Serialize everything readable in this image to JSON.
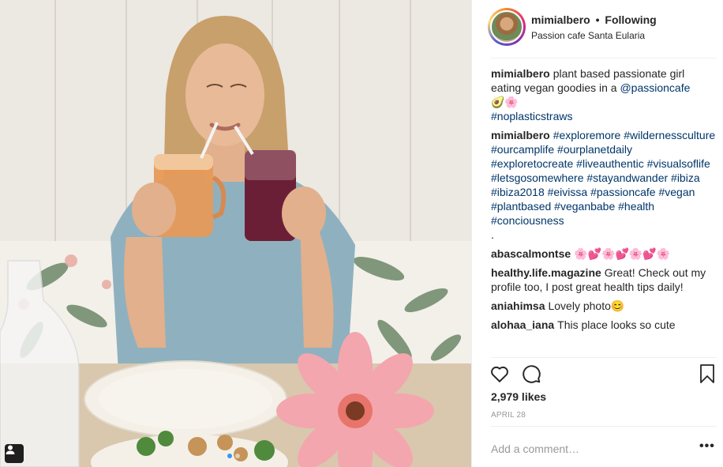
{
  "post": {
    "username": "mimialbero",
    "separator": "•",
    "follow_status": "Following",
    "location": "Passion cafe Santa Eularia"
  },
  "comments": [
    {
      "user": "mimialbero",
      "lead": "plant based passionate girl eating vegan goodies in a",
      "mention": "@passioncafe",
      "emoji": "🥑🌸",
      "tags": "#noplasticstraws"
    },
    {
      "user": "mimialbero",
      "tags": "#exploremore #wildernessculture #ourcamplife #ourplanetdaily #exploretocreate #liveauthentic #visualsoflife #letsgosomewhere #stayandwander #ibiza #ibiza2018 #eivissa #passioncafe #vegan #plantbased #veganbabe #health #conciousness",
      "trail": "."
    },
    {
      "user": "abascalmontse",
      "text": "🌸💕🌸💕🌸💕🌸"
    },
    {
      "user": "healthy.life.magazine",
      "text": "Great! Check out my profile too, I post great health tips daily!"
    },
    {
      "user": "aniahimsa",
      "text": "Lovely photo😊"
    },
    {
      "user": "alohaa_iana",
      "text": "This place looks so cute"
    }
  ],
  "likes": "2,979 likes",
  "date": "APRIL 28",
  "comment_box": {
    "placeholder": "Add a comment…"
  },
  "more_label": "•••",
  "icons": {
    "like": "heart-icon",
    "comment": "comment-bubble-icon",
    "save": "bookmark-icon",
    "tagged": "user-tag-icon"
  },
  "carousel": {
    "count": 2,
    "active": 1
  },
  "colors": {
    "link": "#003569",
    "muted": "#999999",
    "dot_active": "#3897f0"
  }
}
